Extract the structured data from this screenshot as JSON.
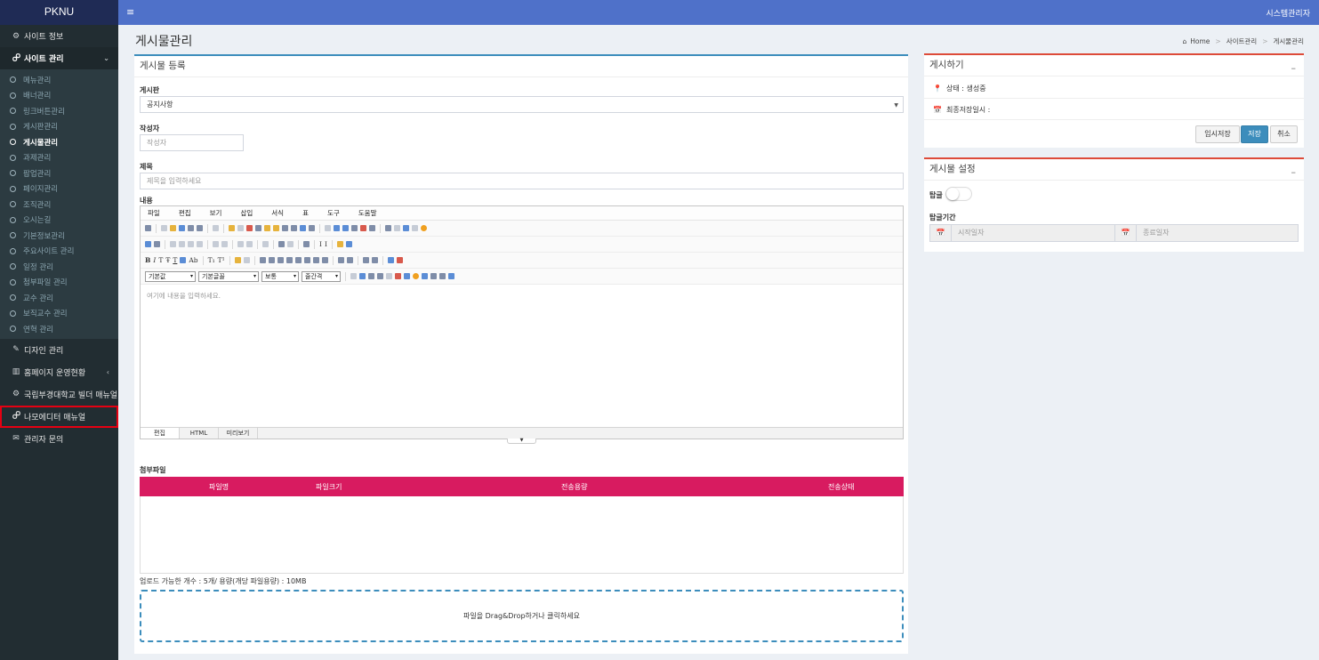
{
  "brand": "PKNU",
  "topbar": {
    "menu_icon": "≡",
    "user": "시스템관리자"
  },
  "sidebar": {
    "top_items": [
      {
        "label": "사이트 정보",
        "icon": "⚙"
      }
    ],
    "active_group": {
      "label": "사이트 관리",
      "icon": "🔗",
      "chevron": "⌄",
      "items": [
        "메뉴관리",
        "배너관리",
        "링크버튼관리",
        "게시판관리",
        "게시물관리",
        "과제관리",
        "팝업관리",
        "페이지관리",
        "조직관리",
        "오시는길",
        "기본정보관리",
        "주요사이트 관리",
        "일정 관리",
        "첨부파일 관리",
        "교수 관리",
        "보직교수 관리",
        "연혁 관리"
      ],
      "active_item": "게시물관리"
    },
    "bottom_items": [
      {
        "label": "디자인 관리",
        "icon": "✎"
      },
      {
        "label": "홈페이지 운영현황",
        "icon": "▥",
        "chevron": "‹"
      },
      {
        "label": "국립부경대학교 빌더 매뉴얼",
        "icon": "⚙"
      },
      {
        "label": "나모에디터 매뉴얼",
        "icon": "🔗",
        "highlighted": true
      },
      {
        "label": "관리자 문의",
        "icon": "✉"
      }
    ],
    "highlight_color": "#e60012"
  },
  "header": {
    "title": "게시물관리",
    "breadcrumb": {
      "home_icon": "⌂",
      "home": "Home",
      "level1": "사이트관리",
      "level2": "게시물관리",
      "separator": ">"
    }
  },
  "main": {
    "title": "게시물 등록",
    "board_label": "게시판",
    "board_value": "공지사항",
    "author_label": "작성자",
    "author_placeholder": "작성자",
    "subject_label": "제목",
    "subject_placeholder": "제목을 입력하세요",
    "content_label": "내용",
    "editor": {
      "menus": [
        "파일",
        "편집",
        "보기",
        "삽입",
        "서식",
        "표",
        "도구",
        "도움말"
      ],
      "style_select": "기본값",
      "font_select": "기본글꼴",
      "size_select": "보통",
      "spacing_select": "줄간격",
      "placeholder": "여기에 내용을 입력하세요.",
      "tabs": [
        "편집",
        "HTML",
        "미리보기"
      ]
    },
    "attach": {
      "label": "첨부파일",
      "columns": [
        "파일명",
        "파일크기",
        "전송용량",
        "전송상태"
      ],
      "header_color": "#d81b60",
      "note": "업로드 가능한 개수 : 5개/ 용량(개당 파일용량) : 10MB",
      "dropzone": "파일을 Drag&Drop하거나 클릭하세요"
    }
  },
  "post_panel": {
    "title": "게시하기",
    "collapse": "–",
    "status_icon": "📍",
    "status": "상태 : 생성중",
    "saved_icon": "📅",
    "saved_label": "최종저장일시 :",
    "btn_draft": "임시저장",
    "btn_save": "저장",
    "btn_cancel": "취소"
  },
  "settings_panel": {
    "title": "게시물 설정",
    "collapse": "–",
    "pin_label": "탑글",
    "pin_period_label": "탑글기간",
    "calendar_icon": "📅",
    "start_placeholder": "시작일자",
    "end_placeholder": "종료일자"
  },
  "colors": {
    "sidebar": "#222d32",
    "topbar": "#4f71c9",
    "primary": "#3c8dbc",
    "danger": "#dd4b39"
  }
}
